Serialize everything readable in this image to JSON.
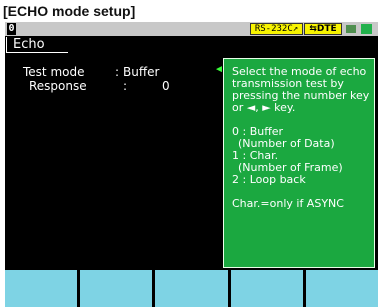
{
  "caption": "[ECHO mode setup]",
  "topbar": {
    "screen_number": "0",
    "rs_label": "RS-232C↗",
    "dte_label": "⇆DTE"
  },
  "tab": {
    "label": "Echo"
  },
  "settings": [
    {
      "label": "Test mode",
      "sep": ":",
      "value": "Buffer"
    },
    {
      "label": "Response",
      "sep": ":",
      "value": "0"
    }
  ],
  "help": {
    "intro": "Select the mode of echo transmission test by pressing the number key or ◄, ► key.",
    "options": [
      "0 : Buffer",
      "(Number of Data)",
      "1 : Char.",
      "(Number of Frame)",
      "2 : Loop back"
    ],
    "note": "Char.=only if ASYNC"
  },
  "function_keys": [
    "",
    "",
    "",
    "",
    ""
  ],
  "colors": {
    "screen_bg": "#000000",
    "help_bg": "#1ba840",
    "fkey_bg": "#7ed3e4",
    "badge_bg": "#f7f300"
  }
}
